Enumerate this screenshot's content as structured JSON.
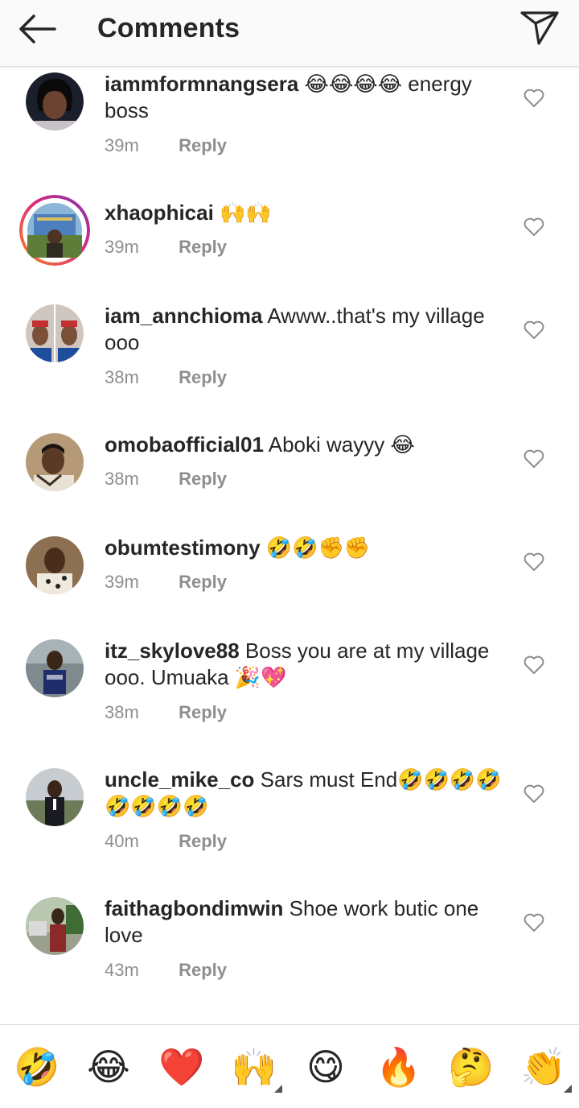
{
  "header": {
    "title": "Comments",
    "back_icon": "back-arrow-icon",
    "send_icon": "paper-plane-icon"
  },
  "colors": {
    "text": "#262626",
    "secondary": "#8e8e8e",
    "divider": "#dbdbdb",
    "story_ring": [
      "#f58529",
      "#dd2a7b",
      "#8134af"
    ]
  },
  "comments": [
    {
      "username": "iammformnangsera",
      "text": "😂😂😂😂 energy boss",
      "time": "39m",
      "reply": "Reply"
    },
    {
      "username": "xhaophicai",
      "text": "🙌🙌",
      "time": "39m",
      "reply": "Reply"
    },
    {
      "username": "iam_annchioma",
      "text": "Awww..that's my village ooo",
      "time": "38m",
      "reply": "Reply"
    },
    {
      "username": "omobaofficial01",
      "text": "Aboki wayyy 😂",
      "time": "38m",
      "reply": "Reply"
    },
    {
      "username": "obumtestimony",
      "text": "🤣🤣✊✊",
      "time": "39m",
      "reply": "Reply"
    },
    {
      "username": "itz_skylove88",
      "text": "Boss you are at my village ooo. Umuaka 🎉💖",
      "time": "38m",
      "reply": "Reply"
    },
    {
      "username": "uncle_mike_co",
      "text": "Sars must End🤣🤣🤣🤣🤣🤣🤣🤣",
      "time": "40m",
      "reply": "Reply"
    },
    {
      "username": "faithagbondimwin",
      "text": "Shoe work butic one love",
      "time": "43m",
      "reply": "Reply"
    }
  ],
  "emoji_bar": [
    "🤣",
    "😂",
    "❤️",
    "🙌",
    "😋",
    "🔥",
    "🤔",
    "👏"
  ]
}
